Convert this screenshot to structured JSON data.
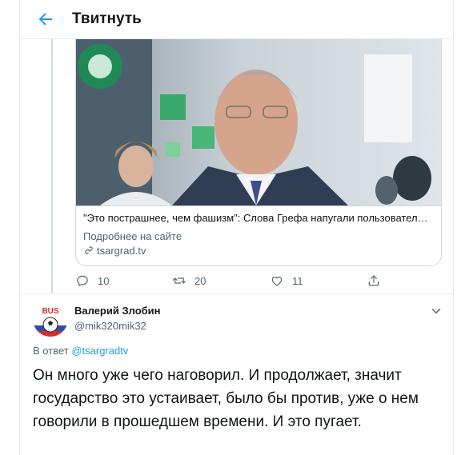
{
  "header": {
    "title": "Твитнуть",
    "back_icon": "arrow-left-icon"
  },
  "link_card": {
    "title": "\"Это пострашнее, чем фашизм\": Слова Грефа напугали пользовател…",
    "more_label": "Подробнее на сайте",
    "domain": "tsargrad.tv"
  },
  "actions": {
    "replies": "10",
    "retweets": "20",
    "likes": "11"
  },
  "reply": {
    "author_name": "Валерий Злобин",
    "author_handle": "@mik320mik32",
    "in_reply_prefix": "В ответ",
    "in_reply_to": "@tsargradtv",
    "text": "Он много уже чего наговорил. И продолжает, значит государство это устаивает, было бы против, уже о нем говорили в прошедшем времени. И это пугает."
  },
  "avatar": {
    "label": "BUS"
  },
  "colors": {
    "accent": "#1d9bf0",
    "muted": "#536471",
    "border": "#e6ecf0"
  }
}
